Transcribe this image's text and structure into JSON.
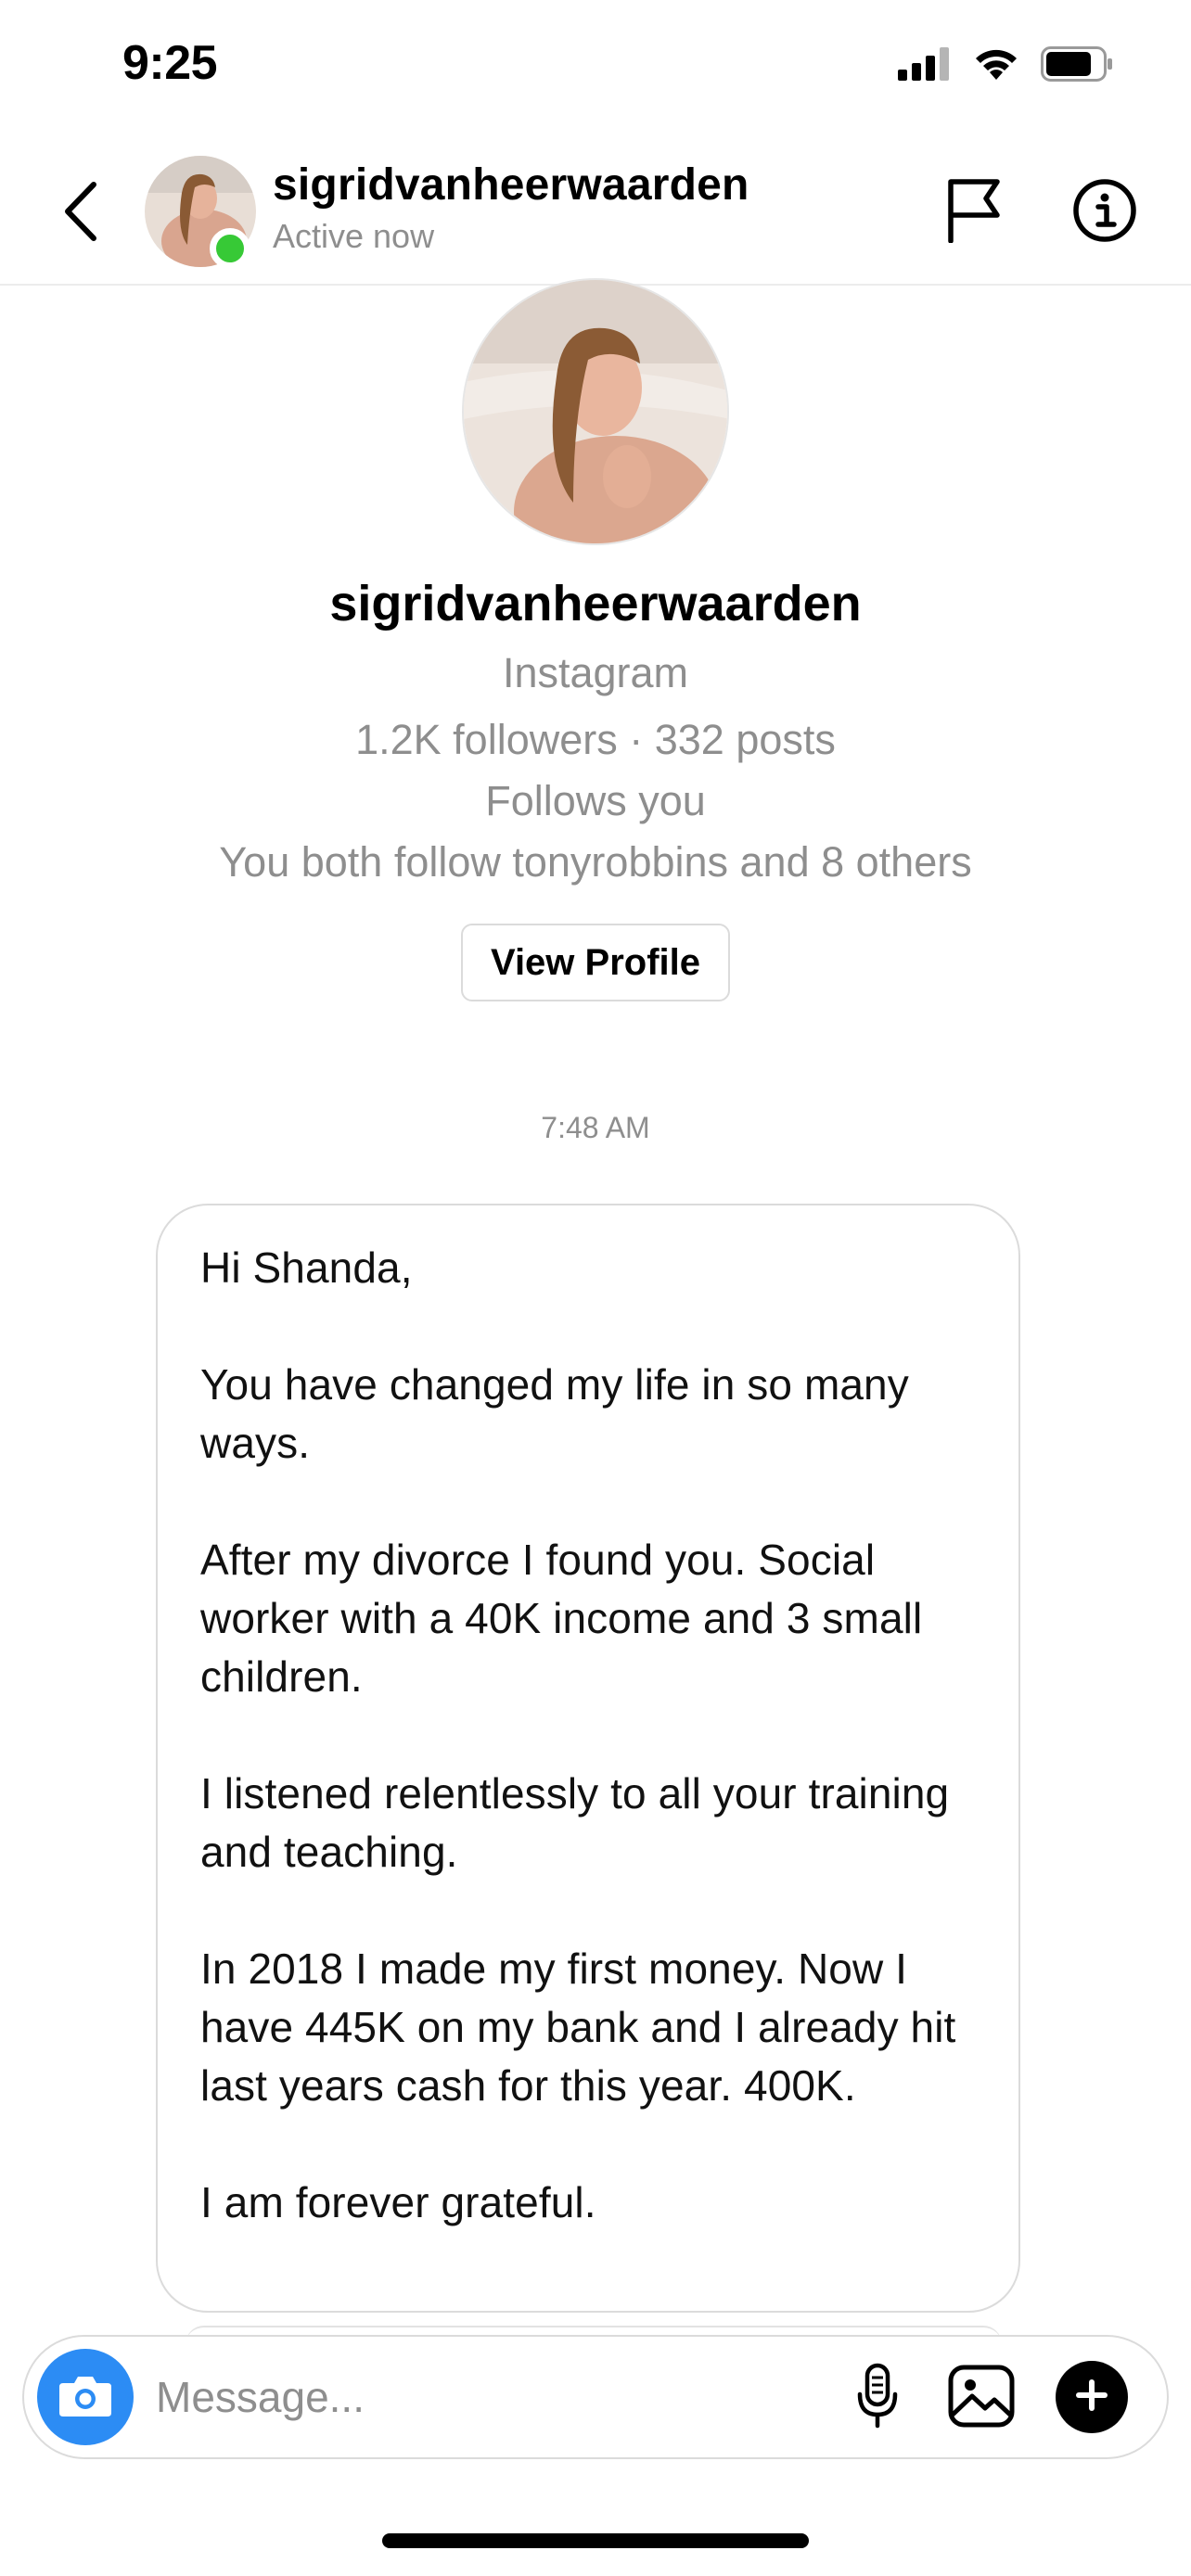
{
  "status_bar": {
    "time": "9:25",
    "icons": [
      "cellular-signal-icon",
      "wifi-icon",
      "battery-icon"
    ]
  },
  "header": {
    "back_icon": "chevron-left-icon",
    "username": "sigridvanheerwaarden",
    "status": "Active now",
    "online_color": "#37c936",
    "flag_icon": "flag-icon",
    "info_icon": "info-icon"
  },
  "profile": {
    "username": "sigridvanheerwaarden",
    "platform": "Instagram",
    "stats": "1.2K followers · 332 posts",
    "follows_you": "Follows you",
    "mutual": "You both follow tonyrobbins and 8 others",
    "view_profile_label": "View Profile"
  },
  "conversation": {
    "timestamp": "7:48 AM",
    "message_paragraphs": [
      "Hi Shanda,",
      "You have changed my life in so many ways.",
      "After my divorce I found you. Social worker with a 40K income and 3 small children.",
      "I listened relentlessly to all your training and teaching.",
      "In 2018 I made my first money. Now I have 445K on my bank and I already hit last years cash for this year. 400K.",
      "I am forever grateful."
    ]
  },
  "composer": {
    "placeholder": "Message...",
    "camera_icon": "camera-icon",
    "mic_icon": "microphone-icon",
    "gallery_icon": "image-gallery-icon",
    "plus_icon": "plus-icon",
    "accent_color": "#2c8cf4"
  }
}
